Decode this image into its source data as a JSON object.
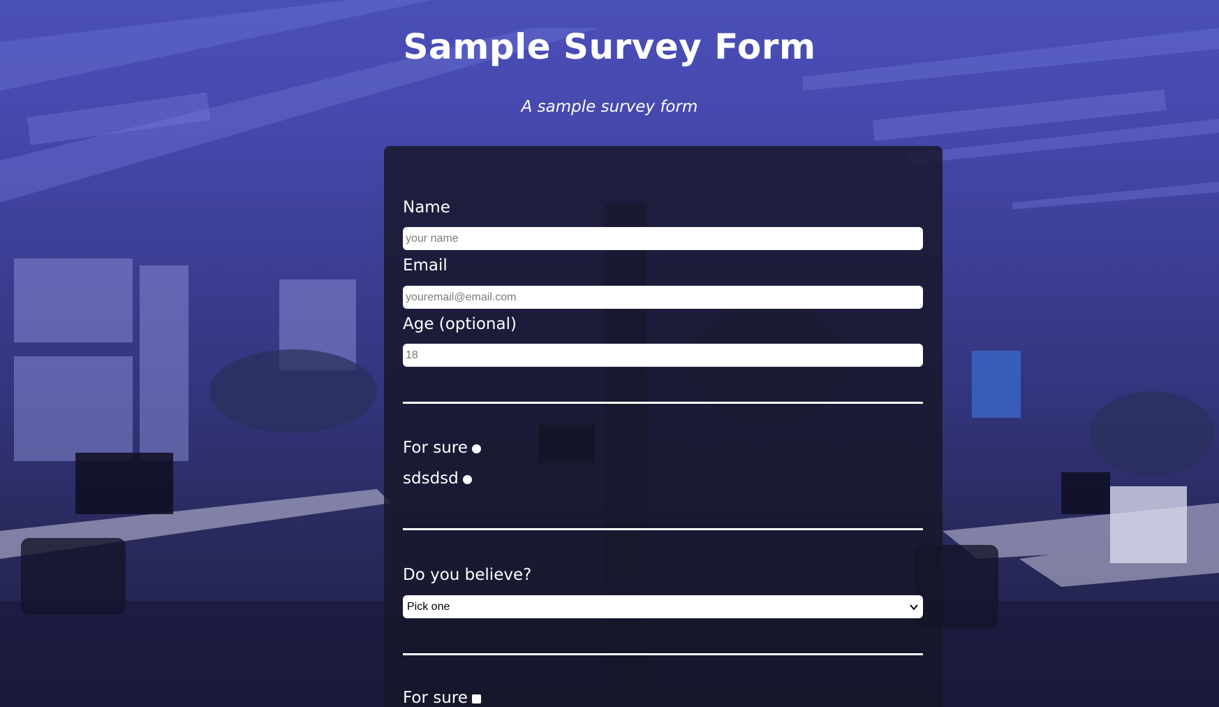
{
  "header": {
    "title": "Sample Survey Form",
    "description": "A sample survey form"
  },
  "form": {
    "name": {
      "label": "Name",
      "placeholder": "your name",
      "value": ""
    },
    "email": {
      "label": "Email",
      "placeholder": "youremail@email.com",
      "value": ""
    },
    "age": {
      "label": "Age (optional)",
      "placeholder": "18",
      "value": ""
    },
    "radios": [
      {
        "label": "For sure",
        "checked": false
      },
      {
        "label": "sdsdsd",
        "checked": false
      }
    ],
    "dropdown": {
      "label": "Do you believe?",
      "selected": "Pick one"
    },
    "checkboxes": [
      {
        "label": "For sure",
        "checked": false
      }
    ]
  },
  "colors": {
    "background_tint": "#4a4fb8",
    "card": "#161628",
    "text": "#ffffff"
  }
}
